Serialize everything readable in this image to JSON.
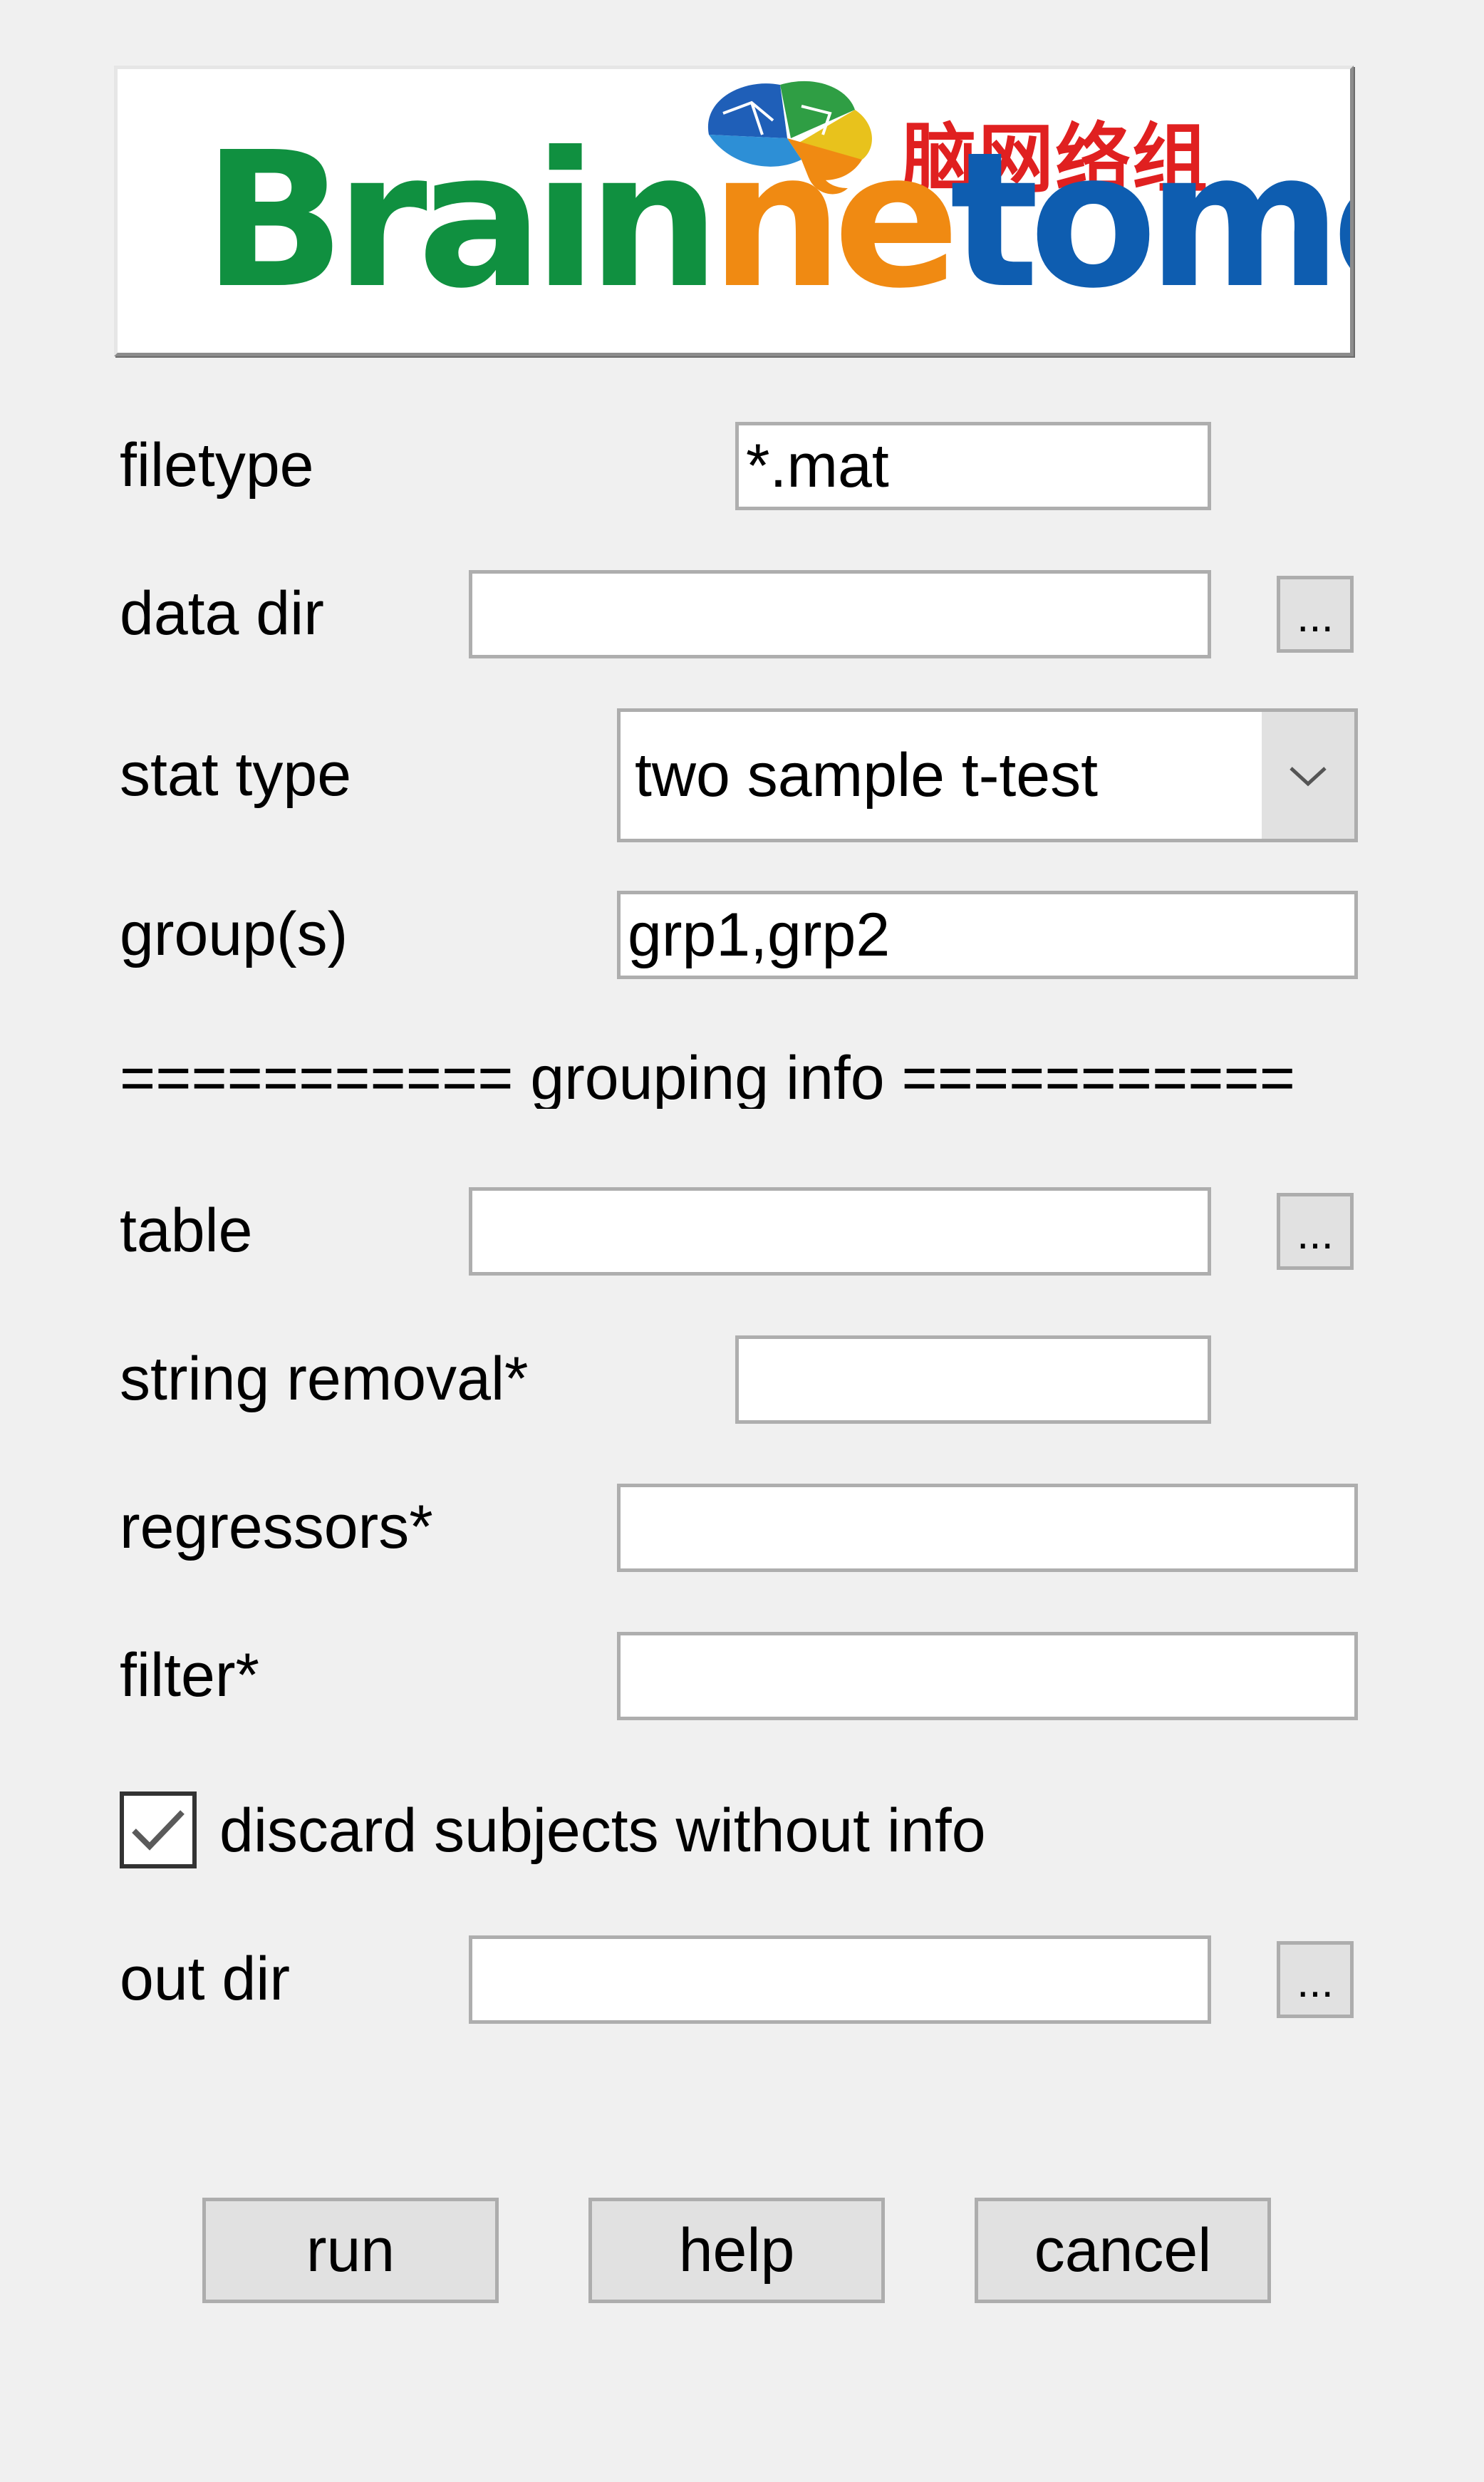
{
  "logo": {
    "word_part1": "Brain",
    "word_part2": "ne",
    "word_part3": "tome",
    "chinese_text": "脑网络组",
    "colors": {
      "green": "#109040",
      "orange": "#f08a12",
      "blue": "#0e5db0",
      "red": "#e02020"
    }
  },
  "form": {
    "filetype": {
      "label": "filetype",
      "value": "*.mat"
    },
    "data_dir": {
      "label": "data dir",
      "value": "",
      "browse_label": "..."
    },
    "stat_type": {
      "label": "stat type",
      "value": "two sample t-test"
    },
    "groups": {
      "label": "group(s)",
      "value": "grp1,grp2"
    },
    "separator": "=========== grouping info ===========",
    "table": {
      "label": "table",
      "value": "",
      "browse_label": "..."
    },
    "string_removal": {
      "label": "string removal*",
      "value": ""
    },
    "regressors": {
      "label": "regressors*",
      "value": ""
    },
    "filter": {
      "label": "filter*",
      "value": ""
    },
    "discard": {
      "label": "discard subjects without info",
      "checked": true
    },
    "out_dir": {
      "label": "out dir",
      "value": "",
      "browse_label": "..."
    }
  },
  "buttons": {
    "run": "run",
    "help": "help",
    "cancel": "cancel"
  },
  "icons": {
    "dropdown": "chevron-down-icon",
    "checkbox": "checkmark-icon",
    "logo": "brain-logo-icon"
  }
}
